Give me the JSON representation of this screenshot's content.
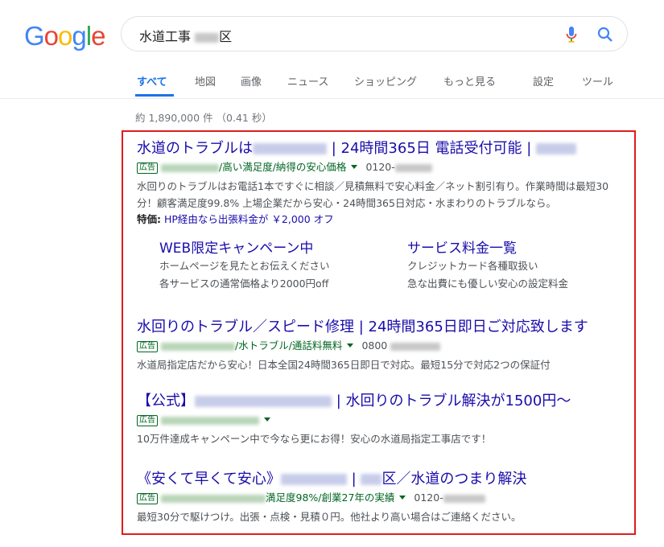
{
  "logo": "Google",
  "search": {
    "query": "水道工事",
    "query_suffix": "区"
  },
  "tabs": [
    {
      "label": "すべて"
    },
    {
      "label": "地図"
    },
    {
      "label": "画像"
    },
    {
      "label": "ニュース"
    },
    {
      "label": "ショッピング"
    },
    {
      "label": "もっと見る"
    },
    {
      "label": "設定"
    },
    {
      "label": "ツール"
    }
  ],
  "stats": "約 1,890,000 件 （0.41 秒）",
  "ads": [
    {
      "title_pre": "水道のトラブルは",
      "title_post": " | 24時間365日 電話受付可能 | ",
      "title_tail": "",
      "badge": "広告",
      "url_tail": "/高い満足度/納得の安心価格",
      "phone": "0120-",
      "desc": "水回りのトラブルはお電話1本ですぐに相談／見積無料で安心料金／ネット割引有り。作業時間は最短30分！顧客満足度99.8% 上場企業だから安心・24時間365日対応・水まわりのトラブルなら。",
      "feature_label": "特価:",
      "feature_text": "HP経由なら出張料金が ￥2,000 オフ",
      "sitelinks": [
        {
          "title": "WEB限定キャンペーン中",
          "lines": [
            "ホームページを見たとお伝えください",
            "各サービスの通常価格より2000円off"
          ]
        },
        {
          "title": "サービス料金一覧",
          "lines": [
            "クレジットカード各種取扱い",
            "急な出費にも優しい安心の設定料金"
          ]
        }
      ]
    },
    {
      "title_pre": "水回りのトラブル／スピード修理 | 24時間365日即日ご対応致します",
      "badge": "広告",
      "url_tail": "/水トラブル/通話料無料",
      "phone": "0800",
      "desc": "水道局指定店だから安心！日本全国24時間365日即日で対応。最短15分で対応2つの保証付"
    },
    {
      "title_pre": "【公式】",
      "title_post": " | 水回りのトラブル解決が1500円〜",
      "badge": "広告",
      "desc": "10万件達成キャンペーン中で今なら更にお得！安心の水道局指定工事店です！"
    },
    {
      "title_pre": "《安くて早くて安心》",
      "title_mid": " | ",
      "title_post": "区／水道のつまり解決",
      "badge": "広告",
      "url_tail": "満足度98%/創業27年の実績",
      "phone": "0120-",
      "desc": "最短30分で駆けつけ。出張・点検・見積０円。他社より高い場合はご連絡ください。"
    }
  ],
  "colors": {
    "link": "#1a0dab",
    "url_green": "#006621",
    "accent": "#1a73e8",
    "highlight_frame": "#e01b1b"
  }
}
